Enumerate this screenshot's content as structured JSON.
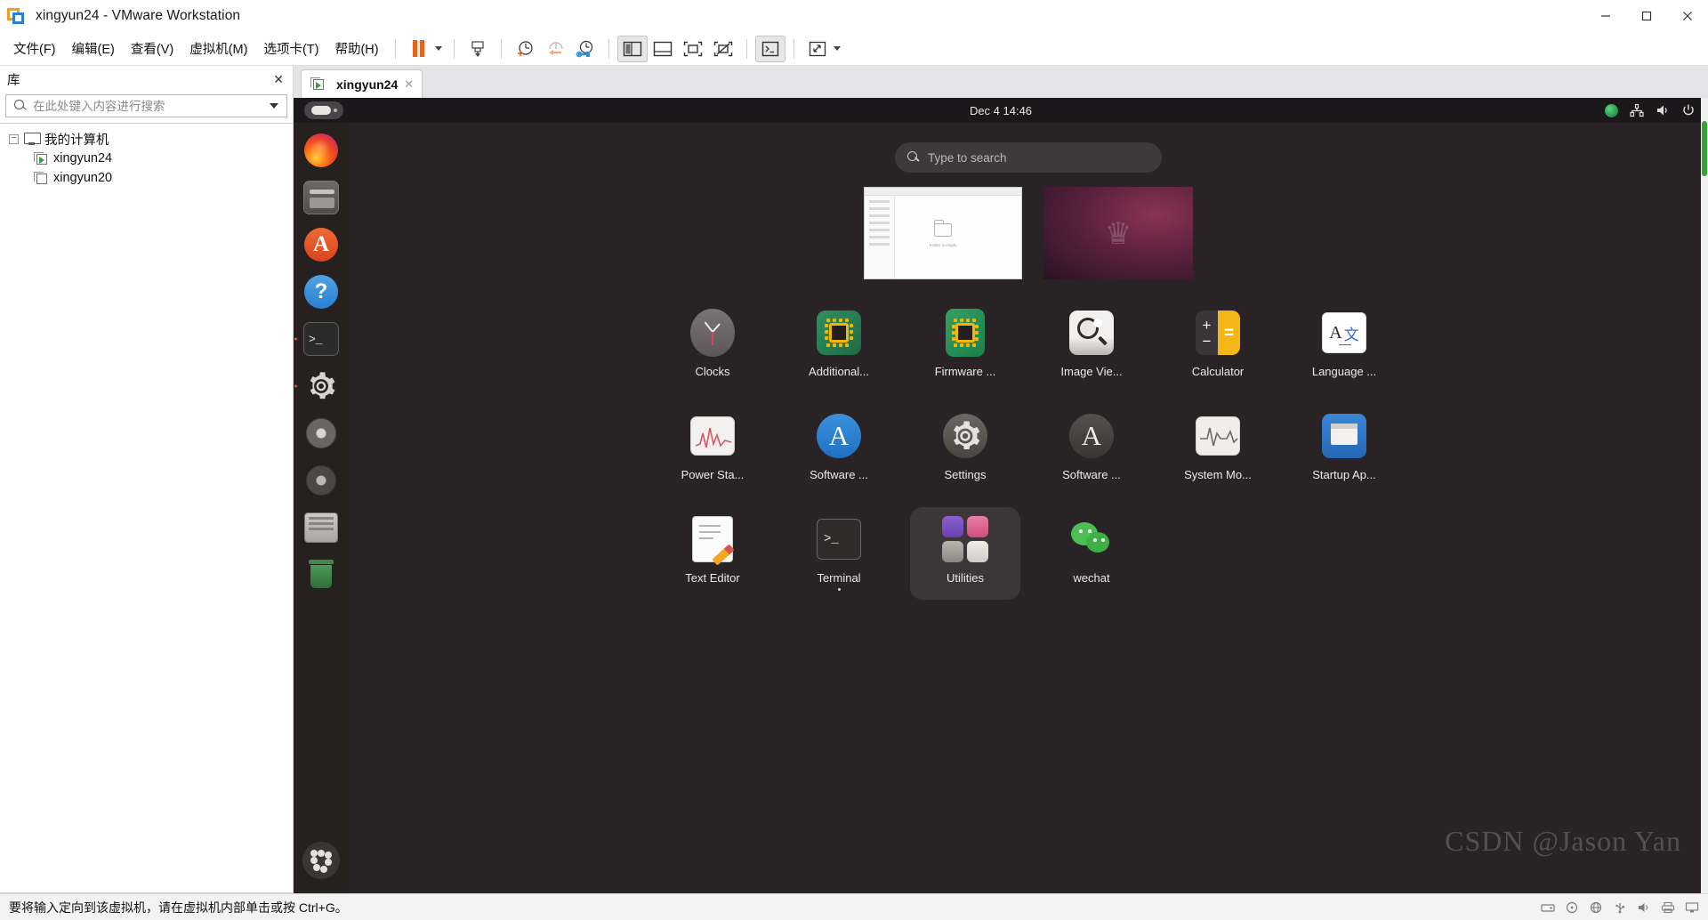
{
  "window": {
    "title": "xingyun24 - VMware Workstation",
    "app_icon": "vmware-logo-icon",
    "minimize": "–",
    "maximize": "❐",
    "close": "✕"
  },
  "menubar": {
    "items": [
      {
        "label": "文件(F)",
        "name": "menu-file"
      },
      {
        "label": "编辑(E)",
        "name": "menu-edit"
      },
      {
        "label": "查看(V)",
        "name": "menu-view"
      },
      {
        "label": "虚拟机(M)",
        "name": "menu-vm"
      },
      {
        "label": "选项卡(T)",
        "name": "menu-tabs"
      },
      {
        "label": "帮助(H)",
        "name": "menu-help"
      }
    ]
  },
  "toolbar": {
    "buttons": [
      {
        "name": "suspend-button",
        "icon": "pause-icon"
      },
      {
        "name": "power-dropdown",
        "icon": "chevron-down-icon"
      },
      {
        "name": "snapshot-take-button",
        "icon": "snapshot-icon"
      },
      {
        "name": "snapshot-manager-button",
        "icon": "clock-plus-icon"
      },
      {
        "name": "revert-snapshot-button",
        "icon": "clock-back-icon"
      },
      {
        "name": "manage-snapshots-button",
        "icon": "clock-wrench-icon"
      },
      {
        "name": "show-library-button",
        "icon": "panel-left-icon"
      },
      {
        "name": "show-thumbnail-bar-button",
        "icon": "panel-bottom-icon"
      },
      {
        "name": "show-console-view-button",
        "icon": "console-view-icon"
      },
      {
        "name": "hide-console-view-button",
        "icon": "console-view-off-icon"
      },
      {
        "name": "unity-mode-button",
        "icon": "terminal-window-icon"
      },
      {
        "name": "fullscreen-button",
        "icon": "expand-icon"
      },
      {
        "name": "fullscreen-dropdown",
        "icon": "chevron-down-icon"
      }
    ]
  },
  "sidebar": {
    "title": "库",
    "close_icon": "✕",
    "search": {
      "placeholder": "在此处键入内容进行搜索",
      "value": "",
      "icon": "search-icon",
      "dropdown_icon": "chevron-down-icon"
    },
    "tree": {
      "root": {
        "label": "我的计算机",
        "expander": "−",
        "icon": "monitor-icon"
      },
      "children": [
        {
          "label": "xingyun24",
          "icon": "vm-running-icon",
          "running": true
        },
        {
          "label": "xingyun20",
          "icon": "vm-stopped-icon",
          "running": false
        }
      ]
    }
  },
  "tabs": [
    {
      "label": "xingyun24",
      "icon": "vm-running-icon",
      "close_icon": "✕",
      "active": true
    }
  ],
  "guest": {
    "topbar": {
      "activities_name": "activities-button",
      "clock": "Dec 4  14:46",
      "status_icons": [
        {
          "name": "language-indicator-icon"
        },
        {
          "name": "network-icon"
        },
        {
          "name": "volume-icon"
        },
        {
          "name": "power-icon"
        }
      ]
    },
    "dock": [
      {
        "name": "dock-item-firefox",
        "icon": "firefox-icon",
        "running": false
      },
      {
        "name": "dock-item-files",
        "icon": "files-icon",
        "running": false
      },
      {
        "name": "dock-item-ubuntu-software",
        "icon": "ubuntu-software-icon",
        "running": false
      },
      {
        "name": "dock-item-help",
        "icon": "help-icon",
        "running": false
      },
      {
        "name": "dock-item-terminal",
        "icon": "terminal-icon",
        "running": true
      },
      {
        "name": "dock-item-settings",
        "icon": "gear-icon",
        "running": true
      },
      {
        "name": "dock-item-disk-1",
        "icon": "disc-icon",
        "running": false
      },
      {
        "name": "dock-item-disk-2",
        "icon": "disc-icon",
        "running": false
      },
      {
        "name": "dock-item-archive",
        "icon": "archive-icon",
        "running": false
      },
      {
        "name": "dock-item-trash",
        "icon": "trash-icon",
        "running": false
      },
      {
        "name": "dock-item-show-applications",
        "icon": "app-grid-icon",
        "running": false
      }
    ],
    "search": {
      "placeholder": "Type to search",
      "icon": "search-icon"
    },
    "workspace_thumbnails": [
      {
        "name": "workspace-thumbnail-files",
        "caption": "Folder is empty"
      },
      {
        "name": "workspace-thumbnail-desktop",
        "caption": ""
      }
    ],
    "apps": [
      {
        "label": "Clocks",
        "icon": "clocks-icon",
        "selected": false,
        "running": false
      },
      {
        "label": "Additional...",
        "icon": "additional-drivers-icon",
        "selected": false,
        "running": false
      },
      {
        "label": "Firmware ...",
        "icon": "firmware-updater-icon",
        "selected": false,
        "running": false
      },
      {
        "label": "Image Vie...",
        "icon": "image-viewer-icon",
        "selected": false,
        "running": false
      },
      {
        "label": "Calculator",
        "icon": "calculator-icon",
        "selected": false,
        "running": false
      },
      {
        "label": "Language ...",
        "icon": "language-support-icon",
        "selected": false,
        "running": false
      },
      {
        "label": "Power Sta...",
        "icon": "power-statistics-icon",
        "selected": false,
        "running": false
      },
      {
        "label": "Software ...",
        "icon": "software-updater-icon",
        "selected": false,
        "running": false
      },
      {
        "label": "Settings",
        "icon": "settings-icon",
        "selected": false,
        "running": false
      },
      {
        "label": "Software ...",
        "icon": "software-sources-icon",
        "selected": false,
        "running": false
      },
      {
        "label": "System Mo...",
        "icon": "system-monitor-icon",
        "selected": false,
        "running": false
      },
      {
        "label": "Startup Ap...",
        "icon": "startup-applications-icon",
        "selected": false,
        "running": false
      },
      {
        "label": "Text Editor",
        "icon": "text-editor-icon",
        "selected": false,
        "running": false
      },
      {
        "label": "Terminal",
        "icon": "terminal-icon",
        "selected": false,
        "running": true
      },
      {
        "label": "Utilities",
        "icon": "utilities-folder-icon",
        "selected": true,
        "running": false
      },
      {
        "label": "wechat",
        "icon": "wechat-icon",
        "selected": false,
        "running": false
      }
    ],
    "watermark": "CSDN @Jason Yan"
  },
  "statusbar": {
    "message": "要将输入定向到该虚拟机，请在虚拟机内部单击或按 Ctrl+G。",
    "icons": [
      {
        "name": "status-harddisk-icon"
      },
      {
        "name": "status-cdrom-icon"
      },
      {
        "name": "status-network-icon"
      },
      {
        "name": "status-usb-icon"
      },
      {
        "name": "status-sound-icon"
      },
      {
        "name": "status-printer-icon"
      },
      {
        "name": "status-display-icon"
      }
    ]
  },
  "colors": {
    "accent_orange": "#e8641c",
    "ubuntu_orange": "#e95420",
    "gnome_dark": "#1b181b",
    "overview_bg": "#2a2326"
  }
}
